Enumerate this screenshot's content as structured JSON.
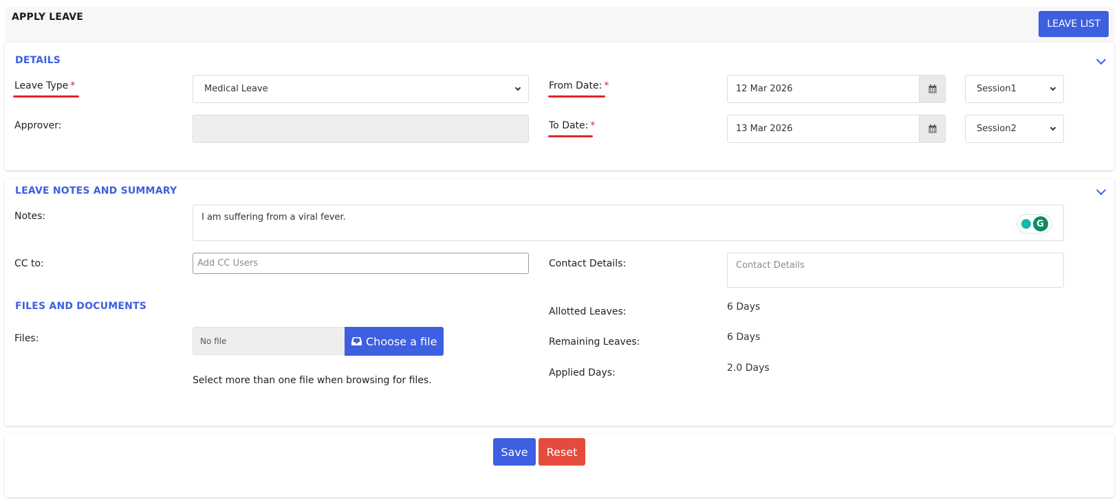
{
  "header": {
    "title": "APPLY LEAVE",
    "leave_list_label": "LEAVE LIST"
  },
  "details": {
    "section_title": "DETAILS",
    "leave_type_label": "Leave Type",
    "leave_type_value": "Medical Leave",
    "approver_label": "Approver:",
    "approver_value": "",
    "from_date_label": "From Date:",
    "from_date_value": "12 Mar 2026",
    "from_session": "Session1",
    "to_date_label": "To Date:",
    "to_date_value": "13 Mar 2026",
    "to_session": "Session2",
    "required_mark": "*"
  },
  "notes_summary": {
    "section_title": "LEAVE NOTES AND SUMMARY",
    "notes_label": "Notes:",
    "notes_value": "I am suffering from a viral fever.",
    "cc_label": "CC to:",
    "cc_placeholder": "Add CC Users",
    "contact_label": "Contact Details:",
    "contact_placeholder": "Contact Details",
    "grammarly_letter": "G"
  },
  "files": {
    "section_title": "FILES AND DOCUMENTS",
    "files_label": "Files:",
    "file_status": "No file",
    "choose_label": "Choose a file",
    "hint": "Select more than one file when browsing for files."
  },
  "summary": {
    "allotted_label": "Allotted Leaves:",
    "allotted_value": "6 Days",
    "remaining_label": "Remaining Leaves:",
    "remaining_value": "6 Days",
    "applied_label": "Applied Days:",
    "applied_value": "2.0 Days"
  },
  "actions": {
    "save_label": "Save",
    "reset_label": "Reset"
  },
  "colors": {
    "accent": "#3d5fe0",
    "required": "#e0262b",
    "reset": "#e44b3c"
  }
}
